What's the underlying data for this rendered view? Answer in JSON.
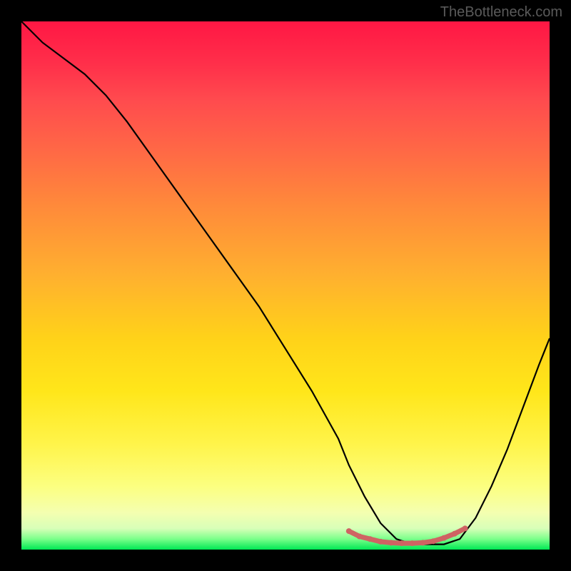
{
  "watermark": "TheBottleneck.com",
  "chart_data": {
    "type": "line",
    "title": "",
    "xlabel": "",
    "ylabel": "",
    "xlim": [
      0,
      100
    ],
    "ylim": [
      0,
      100
    ],
    "grid": false,
    "legend": false,
    "series": [
      {
        "name": "bottleneck-curve",
        "color": "#000000",
        "x": [
          0,
          4,
          8,
          12,
          16,
          20,
          25,
          30,
          35,
          40,
          45,
          50,
          55,
          60,
          62,
          65,
          68,
          71,
          74,
          77,
          80,
          83,
          86,
          89,
          92,
          95,
          98,
          100
        ],
        "values": [
          100,
          96,
          93,
          90,
          86,
          81,
          74,
          67,
          60,
          53,
          46,
          38,
          30,
          21,
          16,
          10,
          5,
          2,
          1,
          1,
          1,
          2,
          6,
          12,
          19,
          27,
          35,
          40
        ]
      },
      {
        "name": "optimal-band-marker",
        "color": "#d86a6a",
        "x": [
          62,
          64,
          66,
          68,
          70,
          72,
          74,
          76,
          78,
          80,
          82,
          84
        ],
        "values": [
          3.5,
          2.5,
          2.0,
          1.5,
          1.3,
          1.2,
          1.2,
          1.3,
          1.6,
          2.2,
          3.0,
          4.0
        ]
      }
    ],
    "background_gradient": {
      "stops": [
        {
          "pct": 0,
          "color": "#ff1744"
        },
        {
          "pct": 15,
          "color": "#ff4b4e"
        },
        {
          "pct": 35,
          "color": "#ff8a3a"
        },
        {
          "pct": 60,
          "color": "#ffd219"
        },
        {
          "pct": 80,
          "color": "#fff44a"
        },
        {
          "pct": 96,
          "color": "#d8ffb8"
        },
        {
          "pct": 100,
          "color": "#00e854"
        }
      ]
    }
  }
}
